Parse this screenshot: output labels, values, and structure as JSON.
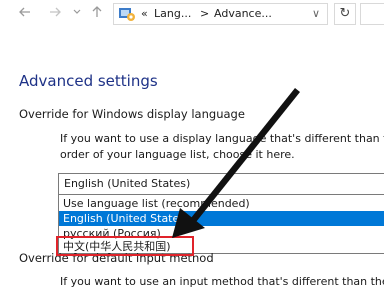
{
  "nav": {
    "back_icon": "arrow-left-icon",
    "forward_icon": "arrow-right-icon",
    "recent_icon": "chevron-down-icon",
    "up_icon": "arrow-up-icon",
    "refresh_glyph": "↻",
    "address": {
      "prefix": "«",
      "crumb1": "Lang...",
      "separator": ">",
      "crumb2": "Advance...",
      "dropdown": "∨"
    }
  },
  "page": {
    "title": "Advanced settings",
    "display_language": {
      "heading": "Override for Windows display language",
      "description_line1": "If you want to use a display language that's different than the",
      "description_line2": "order of your language list, choose it here.",
      "selected_value": "English (United States)",
      "options": [
        "Use language list (recommended)",
        "English (United States)",
        "русский (Россия)",
        "中文(中华人民共和国)"
      ],
      "highlighted_option_index": 1
    },
    "input_method": {
      "heading": "Override for default input method",
      "description_line1": "If you want to use an input method that's different than the fi"
    }
  },
  "colors": {
    "title": "#1e3287",
    "selection": "#0078d7",
    "annotation_box": "#e0232a",
    "annotation_arrow": "#111111"
  }
}
